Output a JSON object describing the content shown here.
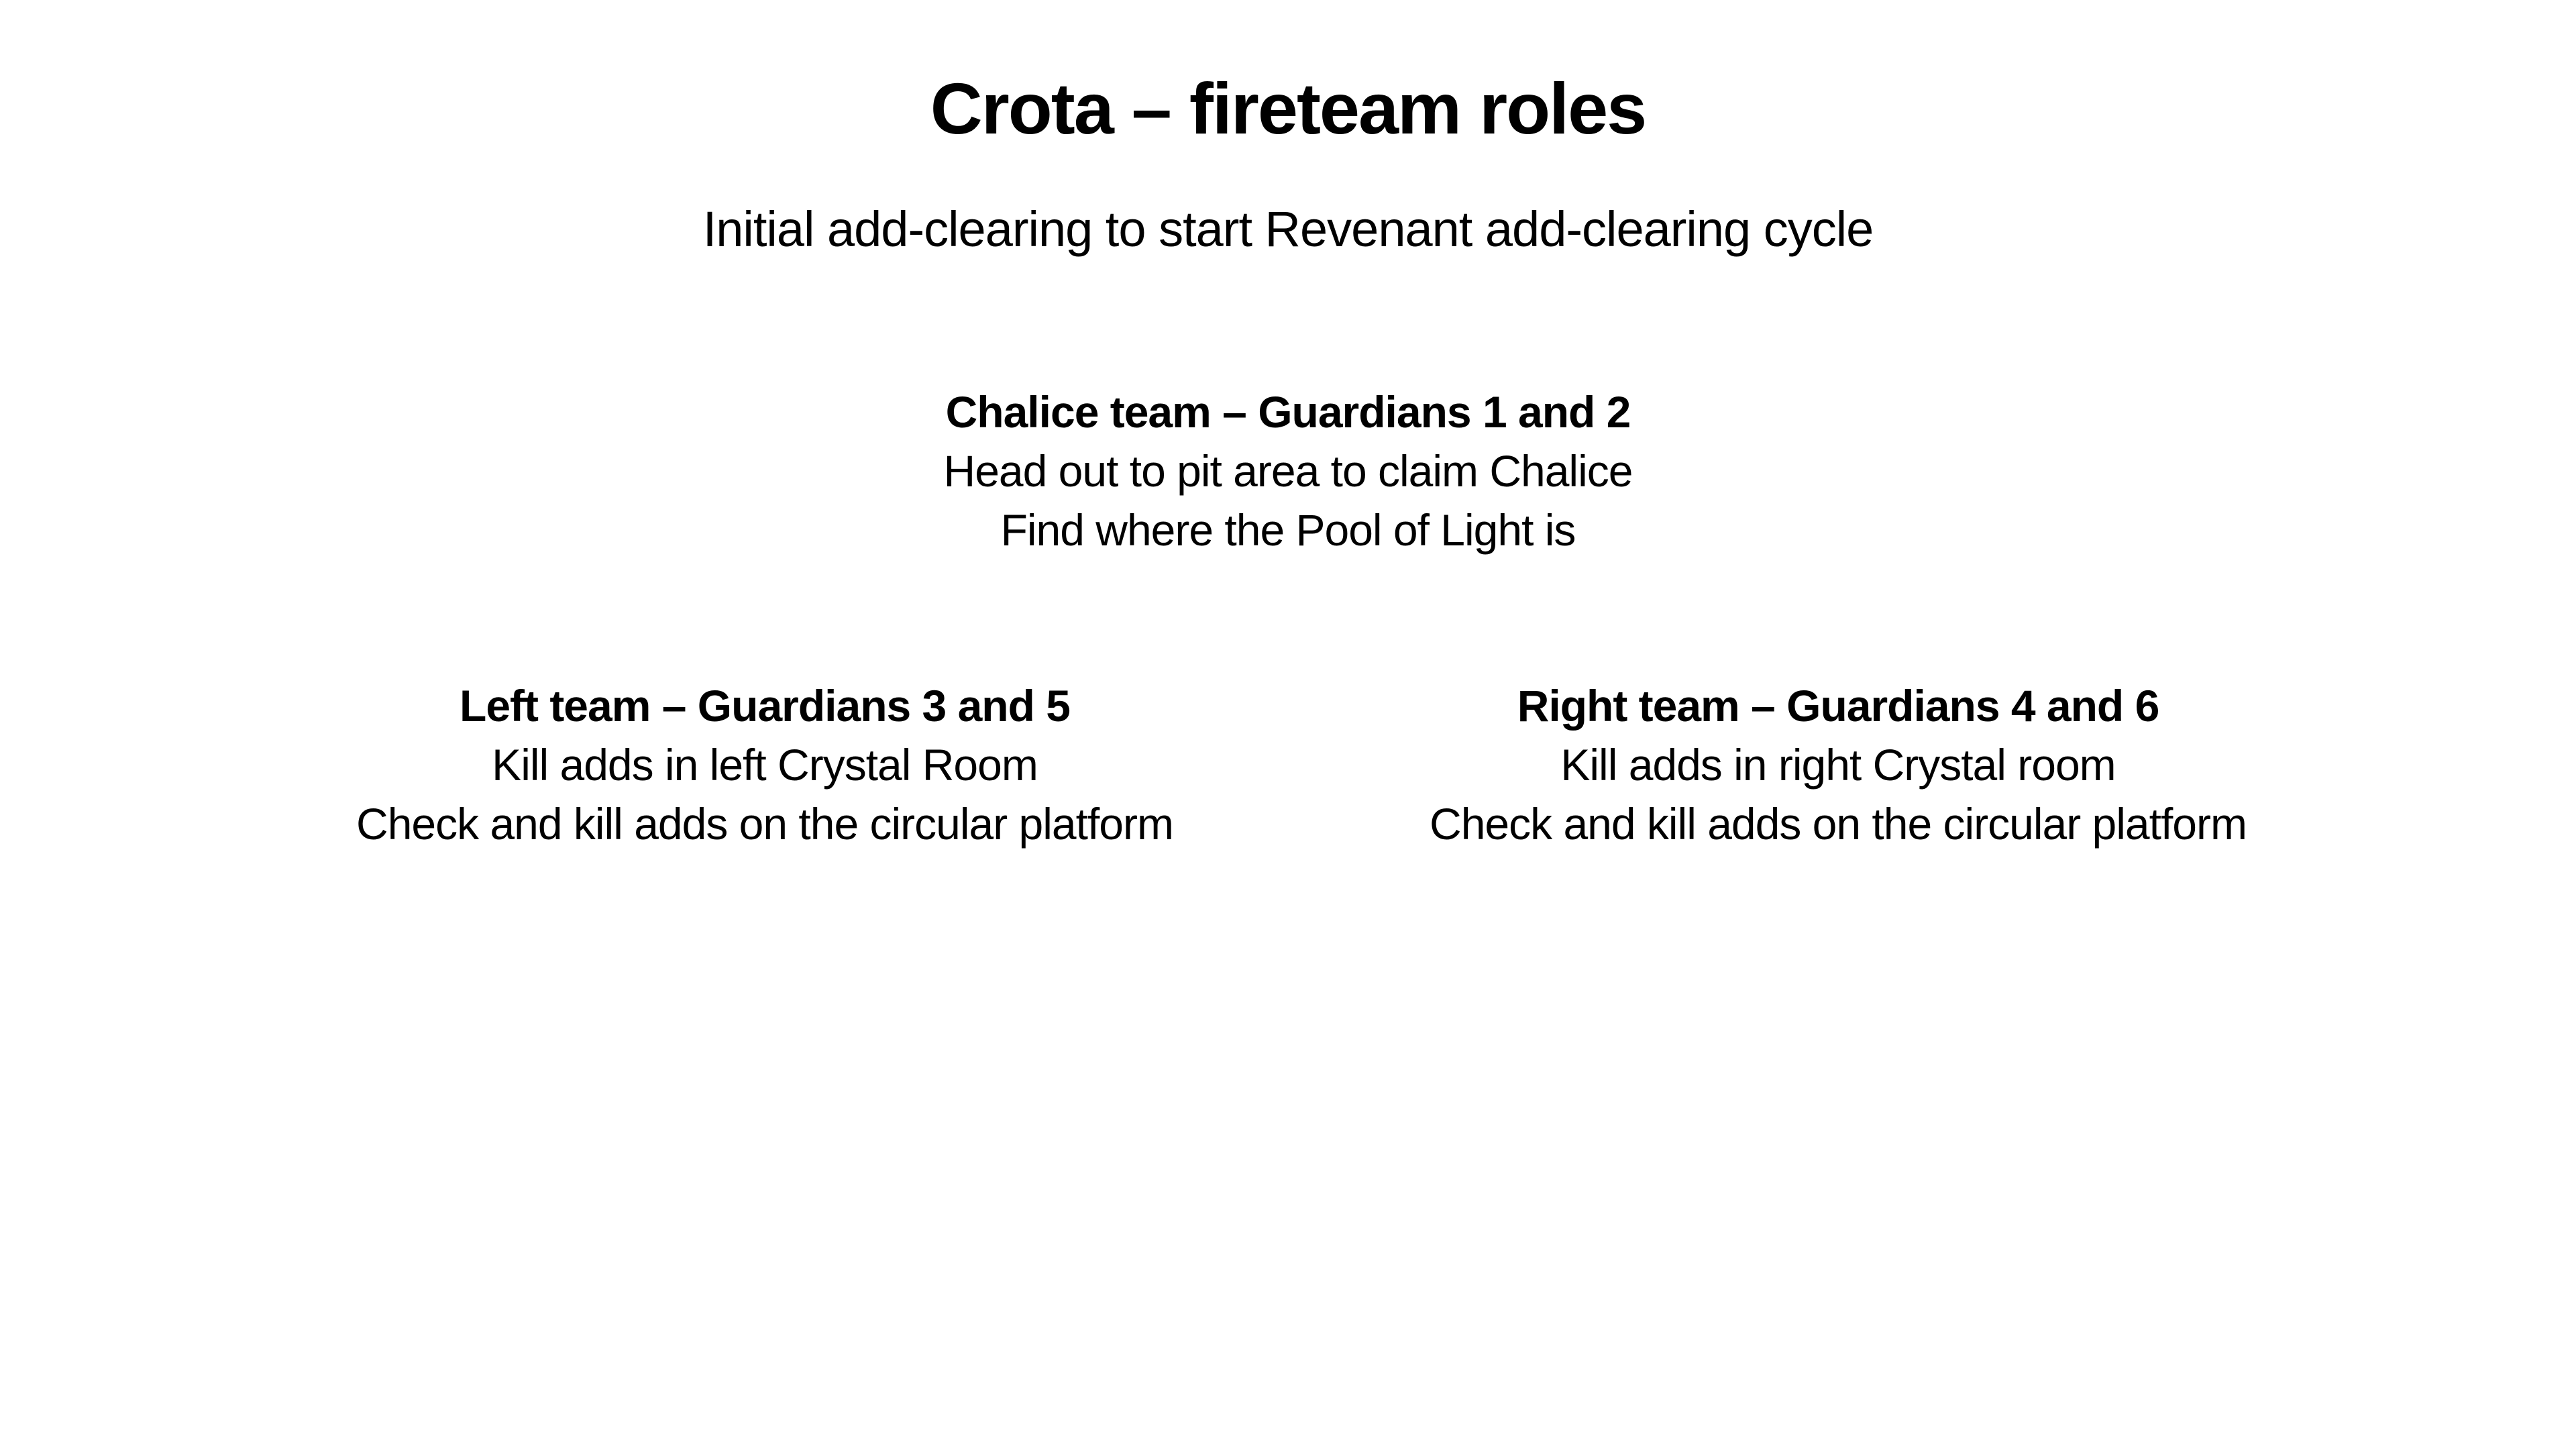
{
  "title": "Crota – fireteam roles",
  "subtitle": "Initial add-clearing to start Revenant add-clearing cycle",
  "teams": {
    "chalice": {
      "heading": "Chalice team – Guardians 1 and 2",
      "tasks": [
        "Head out to pit area to claim Chalice",
        "Find where the Pool of Light is"
      ]
    },
    "left": {
      "heading": "Left team – Guardians 3 and 5",
      "tasks": [
        "Kill adds in left Crystal Room",
        "Check and kill adds on the circular platform"
      ]
    },
    "right": {
      "heading": "Right team – Guardians 4 and 6",
      "tasks": [
        "Kill adds in right Crystal room",
        "Check and kill adds on the circular platform"
      ]
    }
  }
}
